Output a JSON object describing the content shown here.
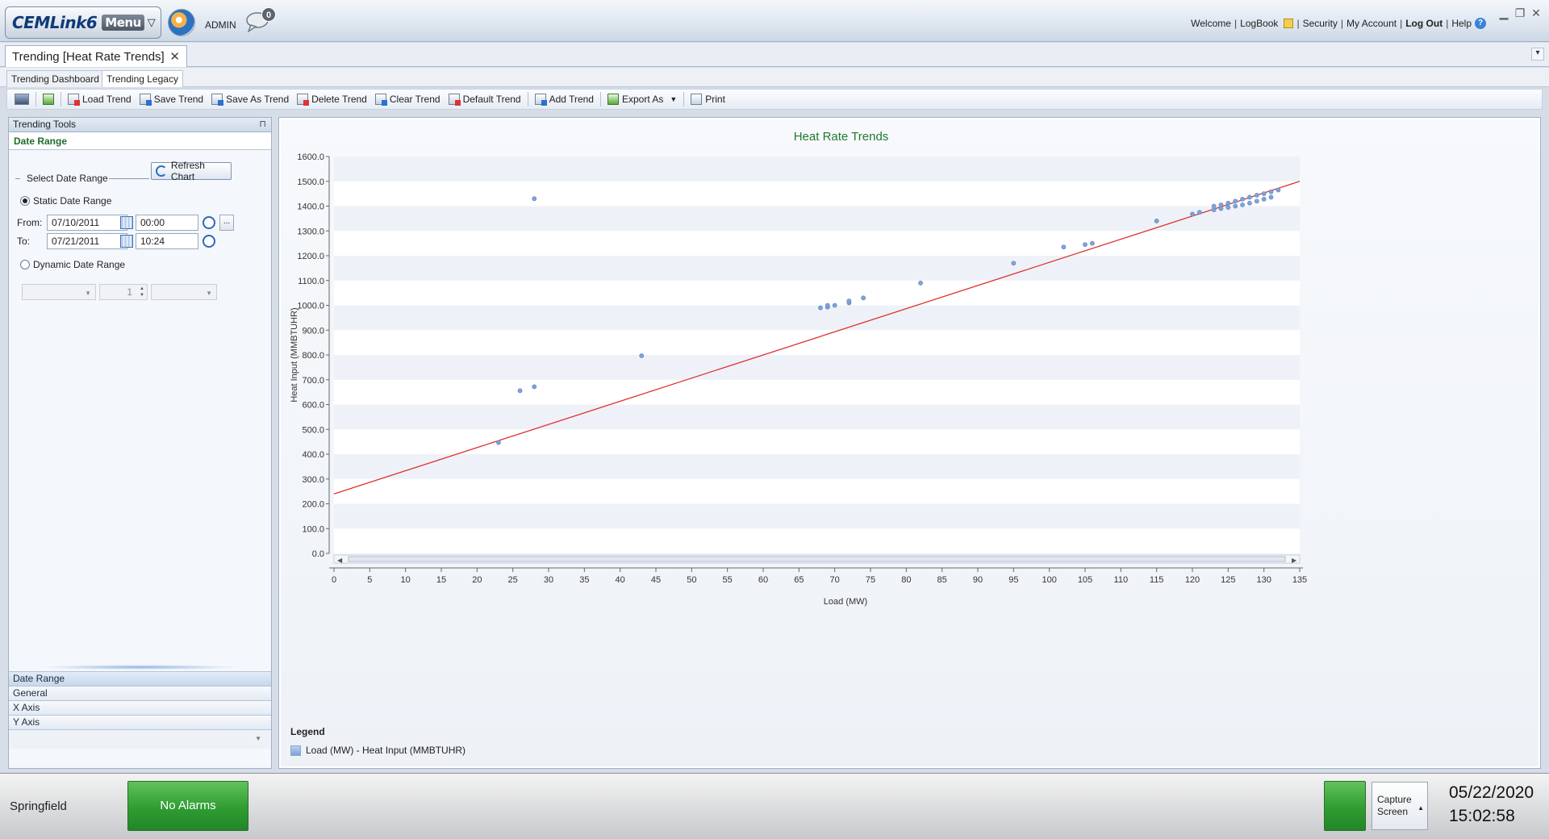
{
  "header": {
    "brand": "CEMLink6",
    "menu_label": "Menu",
    "user": "ADMIN",
    "message_count": "0",
    "links": [
      "Welcome",
      "LogBook",
      "Security",
      "My Account",
      "Log Out",
      "Help"
    ]
  },
  "doc_tab": {
    "title": "Trending [Heat Rate Trends]"
  },
  "sub_tabs": [
    "Trending Dashboard",
    "Trending Legacy"
  ],
  "toolbar": {
    "load": "Load Trend",
    "save": "Save Trend",
    "save_as": "Save As Trend",
    "delete": "Delete Trend",
    "clear": "Clear Trend",
    "default": "Default Trend",
    "add": "Add Trend",
    "export": "Export As",
    "print": "Print"
  },
  "left_panel": {
    "header": "Trending Tools",
    "section": "Date Range",
    "select_date_range": "Select Date Range",
    "refresh": "Refresh Chart",
    "static_label": "Static Date Range",
    "from_label": "From:",
    "from_date": "07/10/2011",
    "from_time": "00:00",
    "to_label": "To:",
    "to_date": "07/21/2011",
    "to_time": "10:24",
    "dynamic_label": "Dynamic Date Range",
    "dynamic_count": "1",
    "nav": [
      "Date Range",
      "General",
      "X Axis",
      "Y Axis"
    ]
  },
  "chart_data": {
    "type": "scatter",
    "title": "Heat Rate Trends",
    "xlabel": "Load (MW)",
    "ylabel": "Heat Input (MMBTUHR)",
    "xlim": [
      0,
      135
    ],
    "ylim": [
      0,
      1600
    ],
    "x_ticks": [
      0,
      5,
      10,
      15,
      20,
      25,
      30,
      35,
      40,
      45,
      50,
      55,
      60,
      65,
      70,
      75,
      80,
      85,
      90,
      95,
      100,
      105,
      110,
      115,
      120,
      125,
      130,
      135
    ],
    "y_ticks": [
      "0.0",
      "100.0",
      "200.0",
      "300.0",
      "400.0",
      "500.0",
      "600.0",
      "700.0",
      "800.0",
      "900.0",
      "1000.0",
      "1100.0",
      "1200.0",
      "1300.0",
      "1400.0",
      "1500.0",
      "1600.0"
    ],
    "series": [
      {
        "name": "Load (MW) - Heat Input (MMBTUHR)",
        "color": "#7ea3d7",
        "points": [
          [
            23,
            447
          ],
          [
            26,
            656
          ],
          [
            28,
            672
          ],
          [
            28,
            1430
          ],
          [
            43,
            797
          ],
          [
            68,
            990
          ],
          [
            69,
            993
          ],
          [
            69,
            1000
          ],
          [
            70,
            1000
          ],
          [
            72,
            1010
          ],
          [
            72,
            1018
          ],
          [
            74,
            1030
          ],
          [
            82,
            1090
          ],
          [
            95,
            1170
          ],
          [
            102,
            1235
          ],
          [
            105,
            1245
          ],
          [
            106,
            1250
          ],
          [
            115,
            1340
          ],
          [
            120,
            1368
          ],
          [
            121,
            1375
          ],
          [
            123,
            1385
          ],
          [
            123,
            1400
          ],
          [
            124,
            1390
          ],
          [
            124,
            1405
          ],
          [
            125,
            1395
          ],
          [
            125,
            1412
          ],
          [
            126,
            1400
          ],
          [
            126,
            1420
          ],
          [
            127,
            1405
          ],
          [
            127,
            1428
          ],
          [
            128,
            1412
          ],
          [
            128,
            1436
          ],
          [
            129,
            1420
          ],
          [
            129,
            1444
          ],
          [
            130,
            1428
          ],
          [
            130,
            1450
          ],
          [
            131,
            1436
          ],
          [
            131,
            1458
          ],
          [
            132,
            1465
          ]
        ]
      }
    ],
    "trendline": {
      "color": "#e03030",
      "from": [
        0,
        240
      ],
      "to": [
        135,
        1500
      ]
    },
    "legend_title": "Legend",
    "grid": "horizontal bands"
  },
  "status": {
    "site": "Springfield",
    "alarm": "No Alarms",
    "capture_line1": "Capture",
    "capture_line2": "Screen",
    "date": "05/22/2020",
    "time": "15:02:58",
    "ok_color": "#2f9c32"
  }
}
